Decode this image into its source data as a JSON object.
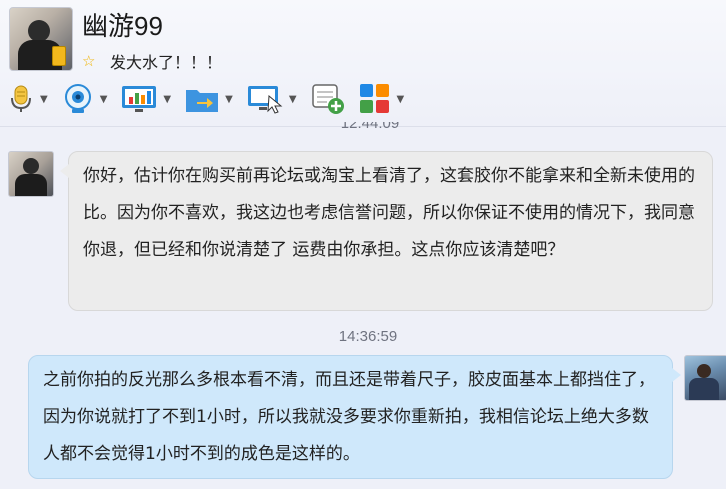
{
  "contact": {
    "name": "幽游99",
    "status": "发大水了！！！"
  },
  "toolbar": {
    "icons": [
      "microphone-icon",
      "webcam-icon",
      "screen-share-icon",
      "file-transfer-icon",
      "remote-assist-icon",
      "add-note-icon",
      "apps-grid-icon"
    ]
  },
  "messages": [
    {
      "timestamp": "12:44:09",
      "sender": "contact",
      "text": "你好，估计你在购买前再论坛或淘宝上看清了，这套胶你不能拿来和全新未使用的比。因为你不喜欢，我这边也考虑信誉问题，所以你保证不使用的情况下，我同意你退，但已经和你说清楚了 运费由你承担。这点你应该清楚吧？"
    },
    {
      "timestamp": "14:36:59",
      "sender": "self",
      "text": "之前你拍的反光那么多根本看不清，而且还是带着尺子，胶皮面基本上都挡住了，因为你说就打了不到1小时，所以我就没多要求你重新拍，我相信论坛上绝大多数人都不会觉得1小时不到的成色是这样的。"
    }
  ],
  "colors": {
    "background": "#eef0f8",
    "incoming_bubble": "#ececec",
    "outgoing_bubble": "#cfe8fb",
    "accent": "#f0b400"
  }
}
